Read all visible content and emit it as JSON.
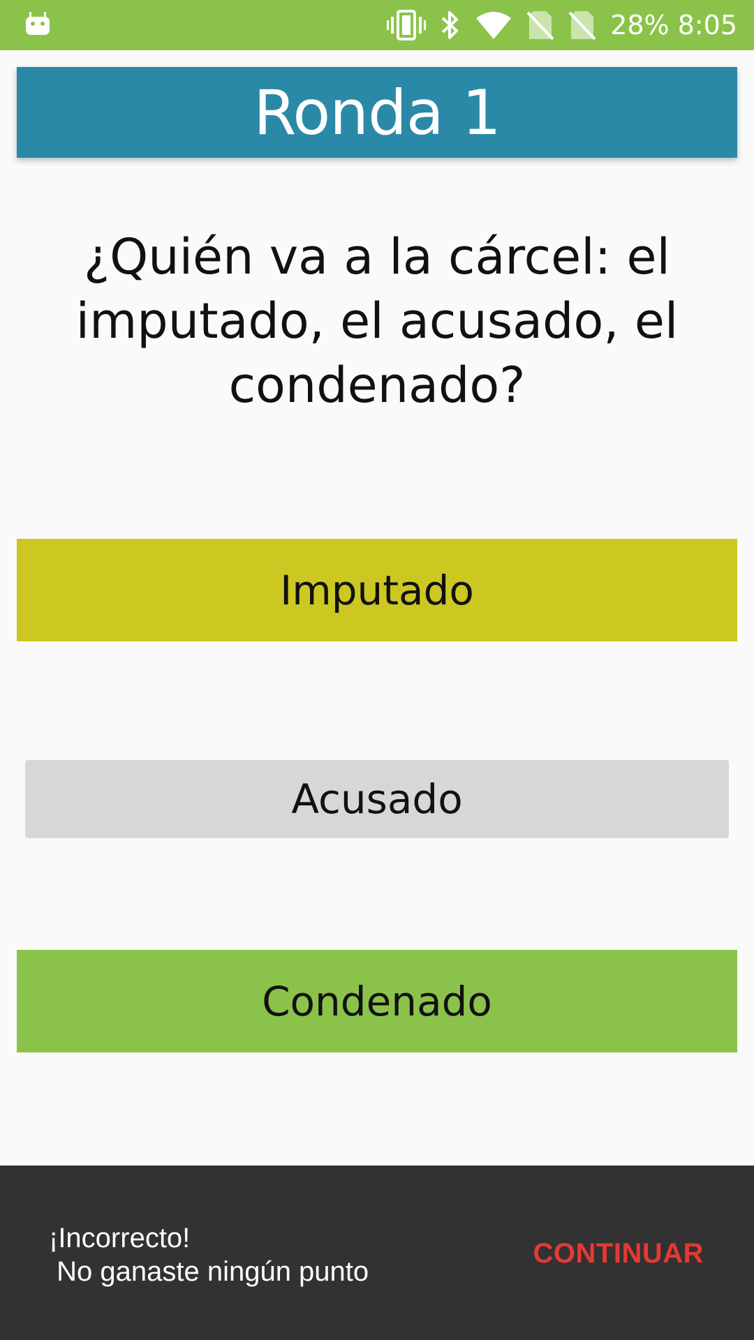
{
  "status_bar": {
    "battery": "28%",
    "time": "8:05",
    "icons": [
      "android-icon",
      "vibrate-icon",
      "bluetooth-icon",
      "wifi-icon",
      "no-sim-icon",
      "no-sim-icon"
    ]
  },
  "header": {
    "title": "Ronda 1",
    "background": "#2b89a8"
  },
  "question": {
    "text": "¿Quién va a la cárcel: el imputado, el acusado, el condenado?"
  },
  "options": [
    {
      "label": "Imputado",
      "color": "#cdc722"
    },
    {
      "label": "Acusado",
      "color": "#d6d7d7"
    },
    {
      "label": "Condenado",
      "color": "#8bc34a"
    }
  ],
  "snackbar": {
    "message": "¡Incorrecto!\n No ganaste ningún punto",
    "action": "CONTINUAR",
    "action_color": "#e53935"
  }
}
